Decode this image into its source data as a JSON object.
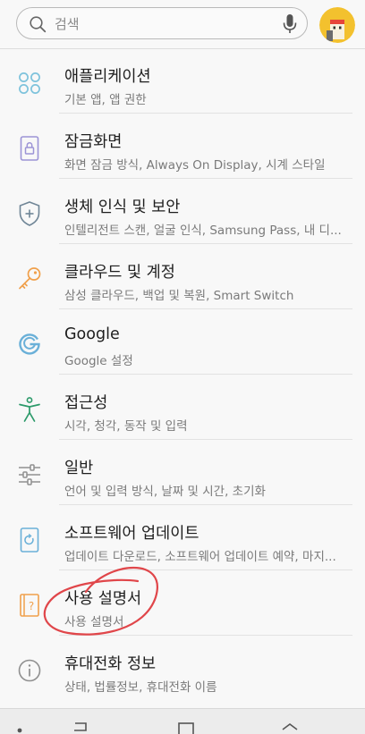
{
  "search": {
    "placeholder": "검색"
  },
  "colors": {
    "icon_blue": "#7ec3dc",
    "icon_purple": "#9c94d6",
    "icon_slate": "#6f8596",
    "icon_orange": "#f0a04b",
    "icon_google_blue": "#6ab0d8",
    "icon_green": "#2c9a6a",
    "icon_gray": "#8f8f8f",
    "annotation_red": "#e0464a"
  },
  "settings": [
    {
      "title": "애플리케이션",
      "subtitle": "기본 앱, 앱 권한",
      "icon": "apps-grid-icon"
    },
    {
      "title": "잠금화면",
      "subtitle": "화면 잠금 방식, Always On Display, 시계 스타일",
      "icon": "lock-screen-icon"
    },
    {
      "title": "생체 인식 및 보안",
      "subtitle": "인텔리전트 스캔, 얼굴 인식, Samsung Pass, 내 디...",
      "icon": "shield-icon"
    },
    {
      "title": "클라우드 및 계정",
      "subtitle": "삼성 클라우드, 백업 및 복원, Smart Switch",
      "icon": "key-icon"
    },
    {
      "title": "Google",
      "subtitle": "Google 설정",
      "icon": "google-g-icon"
    },
    {
      "title": "접근성",
      "subtitle": "시각, 청각, 동작 및 입력",
      "icon": "accessibility-icon"
    },
    {
      "title": "일반",
      "subtitle": "언어 및 입력 방식, 날짜 및 시간, 초기화",
      "icon": "sliders-icon"
    },
    {
      "title": "소프트웨어 업데이트",
      "subtitle": "업데이트 다운로드, 소프트웨어 업데이트 예약, 마지...",
      "icon": "software-update-icon"
    },
    {
      "title": "사용 설명서",
      "subtitle": "사용 설명서",
      "icon": "user-manual-icon"
    },
    {
      "title": "휴대전화 정보",
      "subtitle": "상태, 법률정보, 휴대전화 이름",
      "icon": "info-icon"
    }
  ],
  "navigation": [
    "recent-apps-icon",
    "back-icon",
    "home-icon",
    "back-arrow-icon"
  ]
}
